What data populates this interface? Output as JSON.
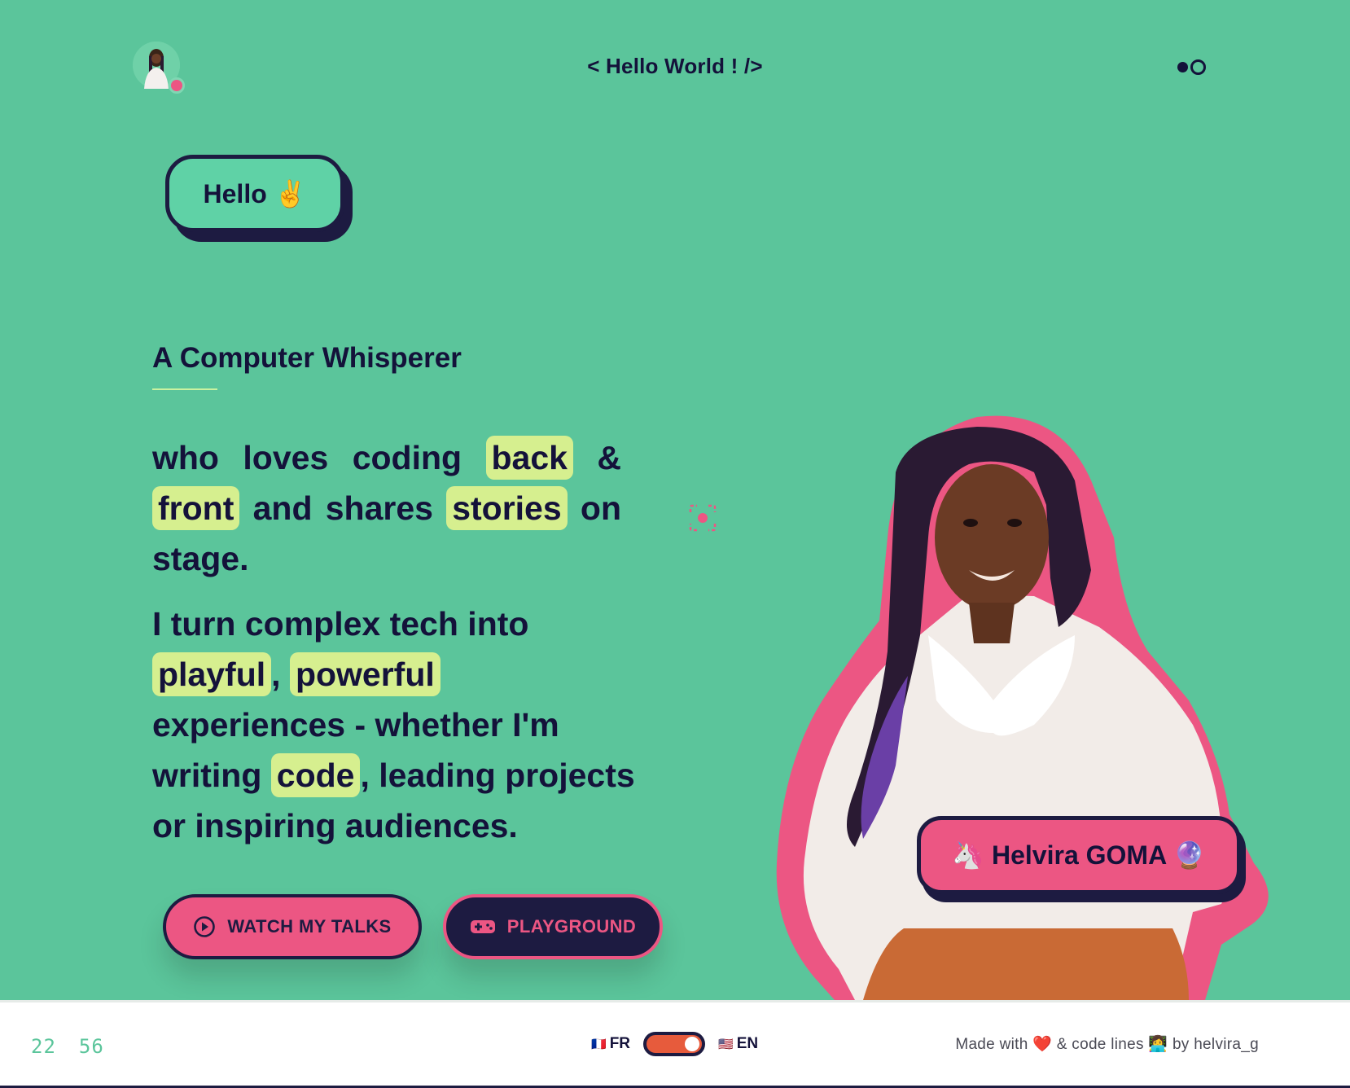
{
  "header": {
    "title": "< Hello World ! />",
    "avatar_icon": "profile-avatar",
    "theme_icon": "theme-toggle-icon"
  },
  "hero": {
    "greeting": "Hello ✌️",
    "subtitle": "A Computer Whisperer",
    "para1": {
      "t1": "who loves coding ",
      "h1": "back",
      "t2": " & ",
      "h2": "front",
      "t3": " and shares ",
      "h3": "stories",
      "t4": " on stage."
    },
    "para2": {
      "t1": "I turn complex tech into ",
      "h1": "playful",
      "t2": ", ",
      "h2": "powerful",
      "t3": " experiences - whether I'm writing ",
      "h3": "code",
      "t4": ", leading projects or inspiring audiences."
    },
    "buttons": {
      "talks": "WATCH MY TALKS",
      "playground": "PLAYGROUND"
    },
    "name_badge": "🦄 Helvira GOMA 🔮"
  },
  "footer": {
    "clock_hours": "22",
    "clock_minutes": "56",
    "lang_fr": "FR",
    "lang_en": "EN",
    "flag_fr": "🇫🇷",
    "flag_en": "🇺🇸",
    "credits": "Made with ❤️ & code lines 👩‍💻 by helvira_g"
  },
  "colors": {
    "background": "#5bc59b",
    "accent_pink": "#ec5683",
    "navy": "#1d1b41",
    "highlight": "#d6ef8f"
  }
}
